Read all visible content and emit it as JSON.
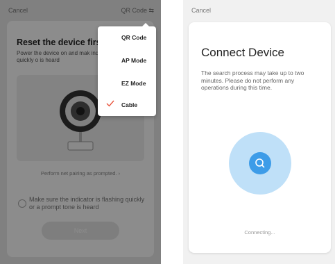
{
  "left_screen": {
    "cancel_label": "Cancel",
    "mode_button_label": "QR Code ⇆",
    "title": "Reset the device firs",
    "description": "Power the device on and mak indicator is flashing quickly o is heard",
    "net_pairing_prompt": "Perform net pairing as prompted. ›",
    "confirm_text": "Make sure the indicator is flashing quickly or a prompt tone is heard",
    "next_label": "Next",
    "menu": [
      {
        "label": "QR Code",
        "selected": false
      },
      {
        "label": "AP Mode",
        "selected": false
      },
      {
        "label": "EZ Mode",
        "selected": false
      },
      {
        "label": "Cable",
        "selected": true
      }
    ],
    "colors": {
      "check": "#e8543d",
      "overlay": "#000000"
    }
  },
  "right_screen": {
    "cancel_label": "Cancel",
    "title": "Connect Device",
    "description": "The search process may take up to two minutes. Please do not perform any operations during this time.",
    "status": "Connecting...",
    "icon": "search-icon",
    "colors": {
      "accent": "#3d9ce8",
      "halo": "#bfe0f8"
    }
  }
}
